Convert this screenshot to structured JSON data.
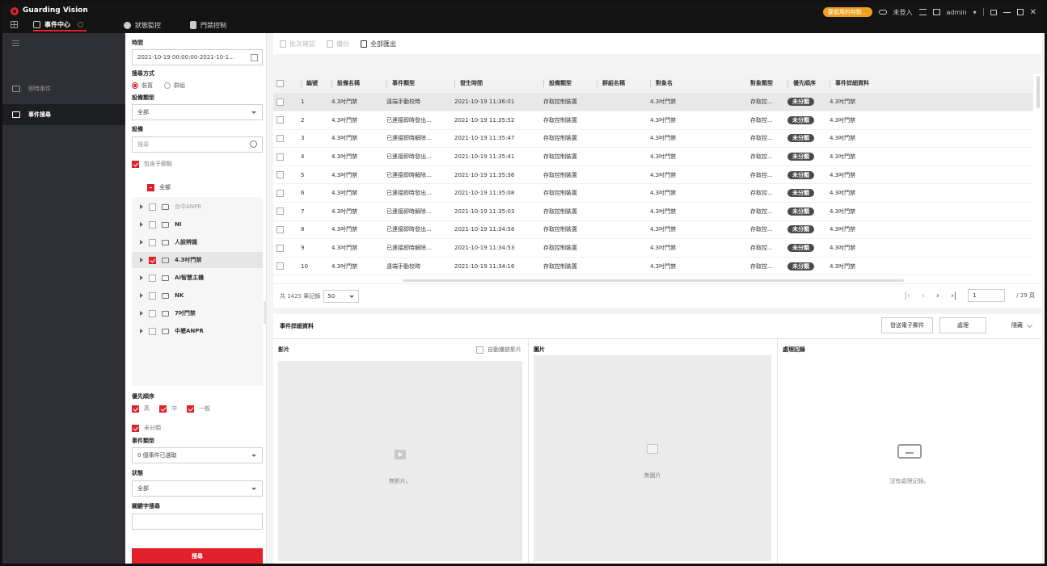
{
  "app": {
    "title": "Guarding Vision"
  },
  "nav_tabs": [
    {
      "label": "事件中心"
    },
    {
      "label": "狀態監控"
    },
    {
      "label": "門禁控制"
    }
  ],
  "titlebar": {
    "promo": "要套用的存取...",
    "login_status": "未登入",
    "user": "admin"
  },
  "leftnav": {
    "items": [
      {
        "label": "即時事件"
      },
      {
        "label": "事件搜尋"
      }
    ]
  },
  "filter": {
    "time_label": "時間",
    "time_value": "2021-10-19 00:00:00-2021-10-1...",
    "search_mode_label": "搜尋方式",
    "mode_device": "裝置",
    "mode_group": "群組",
    "device_type_label": "設備類型",
    "device_type_value": "全部",
    "device_label": "設備",
    "device_search_placeholder": "搜尋",
    "include_sub": "包含子節點",
    "tree_root": "全部",
    "tree_items": [
      {
        "label": "台中ANPR"
      },
      {
        "label": "NI"
      },
      {
        "label": "人臉辨識"
      },
      {
        "label": "4.3吋門禁"
      },
      {
        "label": "AI智慧主機"
      },
      {
        "label": "NK"
      },
      {
        "label": "7吋門禁"
      },
      {
        "label": "中壢ANPR"
      }
    ],
    "priority_label": "優先順序",
    "priority_high": "高",
    "priority_mid": "中",
    "priority_normal": "一般",
    "priority_unclassified": "未分類",
    "event_type_label": "事件類型",
    "event_type_value": "0 個事件已選取",
    "status_label": "狀態",
    "status_value": "全部",
    "keyword_label": "關鍵字搜尋",
    "search_button": "搜尋"
  },
  "toolbar": {
    "batch_confirm": "批次確認",
    "backup": "備份",
    "export_all": "全部匯出"
  },
  "table": {
    "headers": [
      "編號",
      "設備名稱",
      "事件類型",
      "發生時間",
      "設備類型",
      "群組名稱",
      "對象名",
      "對象類型",
      "優先順序",
      "事件詳細資料"
    ],
    "rows": [
      [
        "1",
        "4.3吋門禁",
        "遠端手動校時",
        "2021-10-19 11:36:01",
        "存取控制裝置",
        "",
        "4.3吋門禁",
        "存取控...",
        "未分類",
        "4.3吋門禁"
      ],
      [
        "2",
        "4.3吋門禁",
        "已連接即時發出...",
        "2021-10-19 11:35:52",
        "存取控制裝置",
        "",
        "4.3吋門禁",
        "存取控...",
        "未分類",
        "4.3吋門禁"
      ],
      [
        "3",
        "4.3吋門禁",
        "已連接即時解除...",
        "2021-10-19 11:35:47",
        "存取控制裝置",
        "",
        "4.3吋門禁",
        "存取控...",
        "未分類",
        "4.3吋門禁"
      ],
      [
        "4",
        "4.3吋門禁",
        "已連接即時發出...",
        "2021-10-19 11:35:41",
        "存取控制裝置",
        "",
        "4.3吋門禁",
        "存取控...",
        "未分類",
        "4.3吋門禁"
      ],
      [
        "5",
        "4.3吋門禁",
        "已連接即時解除...",
        "2021-10-19 11:35:36",
        "存取控制裝置",
        "",
        "4.3吋門禁",
        "存取控...",
        "未分類",
        "4.3吋門禁"
      ],
      [
        "6",
        "4.3吋門禁",
        "已連接即時發出...",
        "2021-10-19 11:35:08",
        "存取控制裝置",
        "",
        "4.3吋門禁",
        "存取控...",
        "未分類",
        "4.3吋門禁"
      ],
      [
        "7",
        "4.3吋門禁",
        "已連接即時解除...",
        "2021-10-19 11:35:03",
        "存取控制裝置",
        "",
        "4.3吋門禁",
        "存取控...",
        "未分類",
        "4.3吋門禁"
      ],
      [
        "8",
        "4.3吋門禁",
        "已連接即時發出...",
        "2021-10-19 11:34:58",
        "存取控制裝置",
        "",
        "4.3吋門禁",
        "存取控...",
        "未分類",
        "4.3吋門禁"
      ],
      [
        "9",
        "4.3吋門禁",
        "已連接即時解除...",
        "2021-10-19 11:34:53",
        "存取控制裝置",
        "",
        "4.3吋門禁",
        "存取控...",
        "未分類",
        "4.3吋門禁"
      ],
      [
        "10",
        "4.3吋門禁",
        "遠端手動校時",
        "2021-10-19 11:34:16",
        "存取控制裝置",
        "",
        "4.3吋門禁",
        "存取控...",
        "未分類",
        "4.3吋門禁"
      ]
    ]
  },
  "pager": {
    "total": "共 1425 筆記錄",
    "per_page": "50",
    "current_page": "1",
    "total_pages": "/ 29 頁"
  },
  "details": {
    "title": "事件詳細資料",
    "send_email": "發送電子郵件",
    "handle": "處理",
    "hide": "隱藏",
    "video_title": "影片",
    "autoplay": "自動播放影片",
    "video_empty": "無影片。",
    "picture_title": "圖片",
    "picture_empty": "無圖片",
    "records_title": "處理記錄",
    "records_empty": "沒有處理記錄。"
  },
  "colors": {
    "accent": "#e0202a",
    "badge": "#4a4a4a",
    "promo": "#f0a020"
  }
}
